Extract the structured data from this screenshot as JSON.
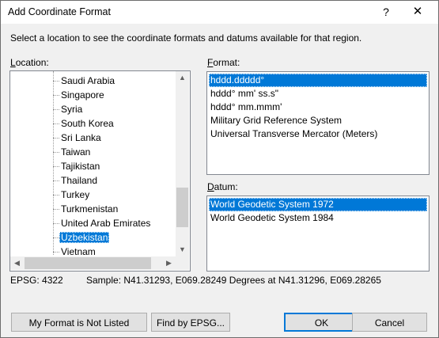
{
  "window": {
    "title": "Add Coordinate Format",
    "help_glyph": "?",
    "close_glyph": "✕"
  },
  "instructions": "Select a location to see the coordinate formats and datums available for that region.",
  "location": {
    "label_underlined": "L",
    "label_rest": "ocation:",
    "items": [
      {
        "label": "Saudi Arabia",
        "selected": false
      },
      {
        "label": "Singapore",
        "selected": false
      },
      {
        "label": "Syria",
        "selected": false
      },
      {
        "label": "South Korea",
        "selected": false
      },
      {
        "label": "Sri Lanka",
        "selected": false
      },
      {
        "label": "Taiwan",
        "selected": false
      },
      {
        "label": "Tajikistan",
        "selected": false
      },
      {
        "label": "Thailand",
        "selected": false
      },
      {
        "label": "Turkey",
        "selected": false
      },
      {
        "label": "Turkmenistan",
        "selected": false
      },
      {
        "label": "United Arab Emirates",
        "selected": false
      },
      {
        "label": "Uzbekistan",
        "selected": true
      },
      {
        "label": "Vietnam",
        "selected": false
      }
    ],
    "scroll_up_glyph": "▲",
    "scroll_down_glyph": "▼",
    "scroll_left_glyph": "◀",
    "scroll_right_glyph": "▶"
  },
  "format": {
    "label_underlined": "F",
    "label_rest": "ormat:",
    "items": [
      {
        "label": "hddd.ddddd°",
        "selected": true
      },
      {
        "label": "hddd° mm' ss.s\"",
        "selected": false
      },
      {
        "label": "hddd° mm.mmm'",
        "selected": false
      },
      {
        "label": "Military Grid Reference System",
        "selected": false
      },
      {
        "label": "Universal Transverse Mercator (Meters)",
        "selected": false
      }
    ]
  },
  "datum": {
    "label_underlined": "D",
    "label_rest": "atum:",
    "items": [
      {
        "label": "World Geodetic System 1972",
        "selected": true
      },
      {
        "label": "World Geodetic System 1984",
        "selected": false
      }
    ]
  },
  "status": {
    "epsg": "EPSG: 4322",
    "sample": "Sample: N41.31293, E069.28249 Degrees at N41.31296, E069.28265"
  },
  "buttons": {
    "not_listed": "My Format is Not Listed",
    "find_epsg": "Find by EPSG...",
    "ok": "OK",
    "cancel": "Cancel"
  },
  "colors": {
    "selection": "#0078d7",
    "dialog_bg": "#f0f0f0"
  }
}
